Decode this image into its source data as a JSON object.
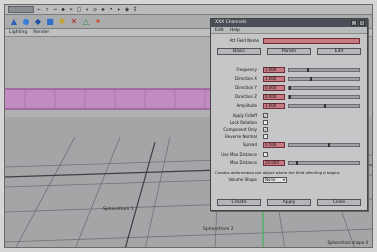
{
  "app": {
    "menu_icons": [
      "←",
      "↑",
      "→",
      "◆",
      "✕",
      "□",
      "✦",
      "◇",
      "◈",
      "•",
      "▸",
      "◉",
      "‡"
    ],
    "shelf_icons": [
      "▲",
      "●",
      "◆",
      "■",
      "✱",
      "✕",
      "△",
      "✶"
    ],
    "viewport_tabs": [
      "Lighting",
      "Render"
    ]
  },
  "viewport": {
    "plane_label_1": "Spherefrom 1",
    "plane_label_2": "Spherefrom 2"
  },
  "dialog": {
    "title": "XXX Channels",
    "menu": [
      "Edit",
      "Help"
    ],
    "name_label": "Att Field Name",
    "name_value": "",
    "tabs": [
      "Basic",
      "Param",
      "Edit"
    ],
    "rows": [
      {
        "label": "Frequency",
        "value": "1.000",
        "knob": 0.25
      },
      {
        "label": "Direction X",
        "value": "1.000",
        "knob": 0.3
      },
      {
        "label": "Direction Y",
        "value": "0.000",
        "knob": 0.0
      },
      {
        "label": "Direction Z",
        "value": "0.000",
        "knob": 0.0
      },
      {
        "label": "Amplitude",
        "value": "1.000",
        "knob": 0.5
      }
    ],
    "checks": [
      {
        "label": "Apply Falloff",
        "checked": true
      },
      {
        "label": "Lock Rotation",
        "checked": false
      },
      {
        "label": "Component Only",
        "checked": true
      },
      {
        "label": "Reverse Normal",
        "checked": false
      }
    ],
    "spread": {
      "label": "Spread",
      "value": "0.500",
      "knob": 0.55
    },
    "use_max": {
      "label": "Use Max Distance",
      "checked": false
    },
    "max_distance": {
      "label": "Max Distance",
      "value": "20.000",
      "knob": 0.1
    },
    "note": "Creates deformation per object where the field affecting it begins",
    "volume": {
      "label": "Volume Shape",
      "value": "None"
    },
    "buttons": [
      "Create",
      "Apply",
      "Close"
    ]
  },
  "status": "Spherefrom shape 4"
}
